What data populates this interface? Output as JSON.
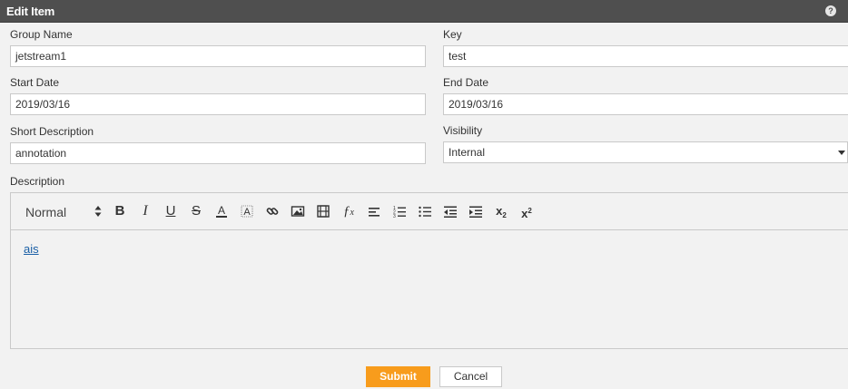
{
  "dialog": {
    "title": "Edit Item",
    "help_icon": "help-icon"
  },
  "form": {
    "group_name": {
      "label": "Group Name",
      "value": "jetstream1"
    },
    "key": {
      "label": "Key",
      "value": "test"
    },
    "start_date": {
      "label": "Start Date",
      "value": "2019/03/16"
    },
    "end_date": {
      "label": "End Date",
      "value": "2019/03/16"
    },
    "short_description": {
      "label": "Short Description",
      "value": "annotation"
    },
    "visibility": {
      "label": "Visibility",
      "value": "Internal"
    },
    "description": {
      "label": "Description"
    }
  },
  "editor": {
    "format_select": "Normal",
    "toolbar_icons": [
      "bold-icon",
      "italic-icon",
      "underline-icon",
      "strikethrough-icon",
      "text-color-icon",
      "background-color-icon",
      "link-icon",
      "image-icon",
      "video-icon",
      "formula-icon",
      "align-icon",
      "ordered-list-icon",
      "bullet-list-icon",
      "outdent-icon",
      "indent-icon",
      "subscript-icon",
      "superscript-icon"
    ],
    "content_link": "ais"
  },
  "actions": {
    "submit": "Submit",
    "cancel": "Cancel"
  },
  "colors": {
    "titlebar": "#4f4f4f",
    "accent": "#f89c1c",
    "link": "#1a5fa6"
  }
}
